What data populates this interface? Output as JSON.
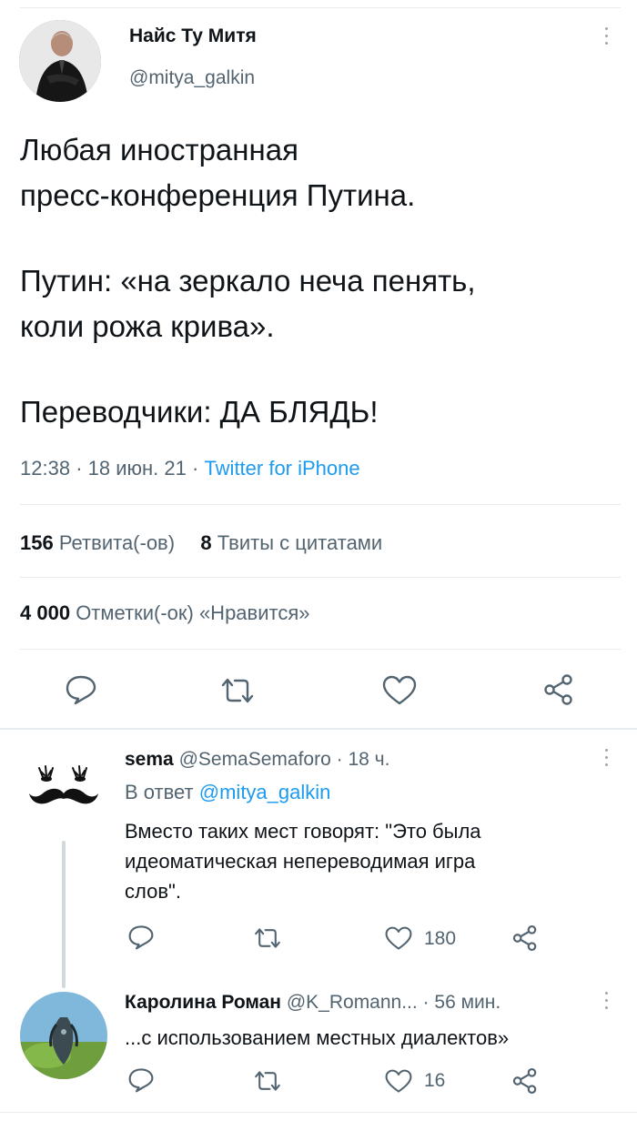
{
  "tweet": {
    "author_name": "Найс Ту Митя",
    "author_handle": "@mitya_galkin",
    "text_lines": [
      "Любая иностранная",
      "пресс-конференция Путина.",
      "Путин: «на зеркало неча пенять,",
      "коли рожа крива».",
      "Переводчики: ДА БЛЯДЬ!"
    ],
    "time": "12:38",
    "date": "18 июн. 21",
    "source": "Twitter for iPhone",
    "sep": "·",
    "retweets_count": "156",
    "retweets_label": "Ретвита(-ов)",
    "quotes_count": "8",
    "quotes_label": "Твиты с цитатами",
    "likes_count": "4 000",
    "likes_label": "Отметки(-ок) «Нравится»"
  },
  "replies": [
    {
      "name": "sema",
      "handle": "@SemaSemaforo",
      "time": "18 ч.",
      "reply_to_prefix": "В ответ",
      "reply_to_handle": "@mitya_galkin",
      "text_lines": [
        "Вместо таких мест говорят: \"Это была",
        "идеоматическая непереводимая игра",
        "слов\"."
      ],
      "likes": "180"
    },
    {
      "name": "Каролина Роман",
      "handle": "@K_Romann...",
      "time": "56 мин.",
      "text_lines": [
        "...с использованием местных диалектов»"
      ],
      "likes": "16"
    }
  ],
  "colors": {
    "link": "#1d9bf0",
    "muted": "#536471",
    "divider": "#e6ecf0"
  },
  "icons": [
    "more-icon",
    "reply-icon",
    "retweet-icon",
    "like-icon",
    "share-icon"
  ]
}
